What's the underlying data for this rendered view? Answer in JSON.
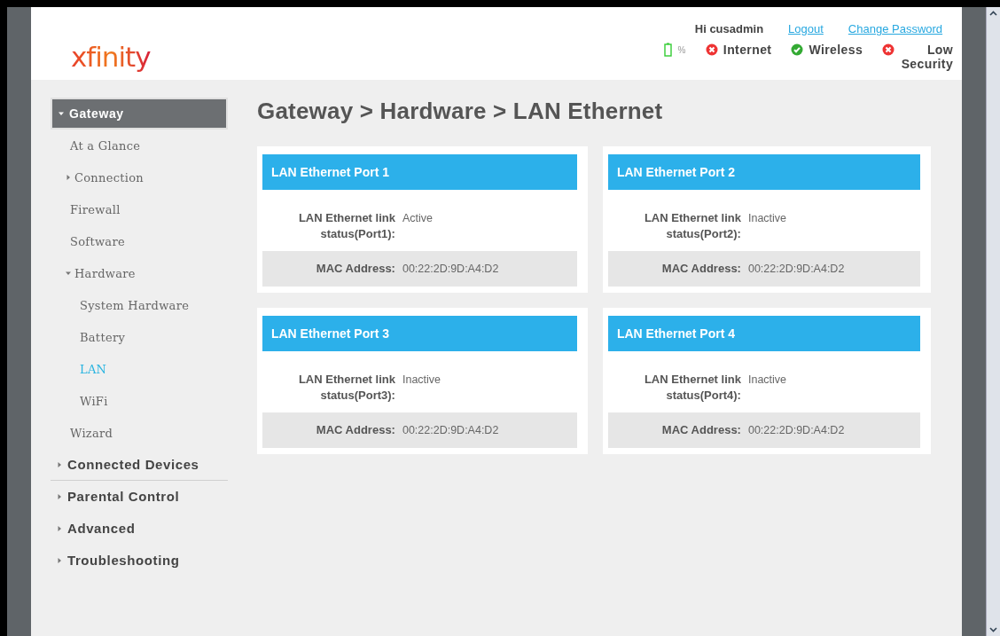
{
  "header": {
    "logo": "xfinity",
    "greeting": "Hi cusadmin",
    "links": [
      {
        "label": "Logout"
      },
      {
        "label": "Change Password"
      }
    ],
    "battery": {
      "label": "%"
    },
    "statuses": [
      {
        "label": "Internet",
        "ok": false
      },
      {
        "label": "Wireless",
        "ok": true
      },
      {
        "label": "Low Security",
        "ok": false
      }
    ]
  },
  "sidebar": {
    "items": [
      {
        "label": "Gateway",
        "selected": true,
        "expanded": true,
        "children": [
          {
            "label": "At a Glance",
            "selected": false
          },
          {
            "label": "Connection",
            "selected": false,
            "expanded": false
          },
          {
            "label": "Firewall",
            "selected": false
          },
          {
            "label": "Software",
            "selected": false
          },
          {
            "label": "Hardware",
            "selected": false,
            "expanded": true,
            "children": [
              {
                "label": "System Hardware",
                "selected": false
              },
              {
                "label": "Battery",
                "selected": false
              },
              {
                "label": "LAN",
                "selected": true
              },
              {
                "label": "WiFi",
                "selected": false
              }
            ]
          },
          {
            "label": "Wizard",
            "selected": false
          }
        ]
      },
      {
        "label": "Connected Devices",
        "selected": false,
        "expanded": false
      },
      {
        "label": "Parental Control",
        "selected": false,
        "expanded": false
      },
      {
        "label": "Advanced",
        "selected": false,
        "expanded": false
      },
      {
        "label": "Troubleshooting",
        "selected": false,
        "expanded": false
      }
    ]
  },
  "page_title": "Gateway > Hardware > LAN Ethernet",
  "ports": [
    {
      "title": "LAN Ethernet Port 1",
      "status_label": "LAN Ethernet link status(Port1):",
      "status": "Active",
      "mac_label": "MAC Address:",
      "mac": "00:22:2D:9D:A4:D2"
    },
    {
      "title": "LAN Ethernet Port 2",
      "status_label": "LAN Ethernet link status(Port2):",
      "status": "Inactive",
      "mac_label": "MAC Address:",
      "mac": "00:22:2D:9D:A4:D2"
    },
    {
      "title": "LAN Ethernet Port 3",
      "status_label": "LAN Ethernet link status(Port3):",
      "status": "Inactive",
      "mac_label": "MAC Address:",
      "mac": "00:22:2D:9D:A4:D2"
    },
    {
      "title": "LAN Ethernet Port 4",
      "status_label": "LAN Ethernet link status(Port4):",
      "status": "Inactive",
      "mac_label": "MAC Address:",
      "mac": "00:22:2D:9D:A4:D2"
    }
  ]
}
